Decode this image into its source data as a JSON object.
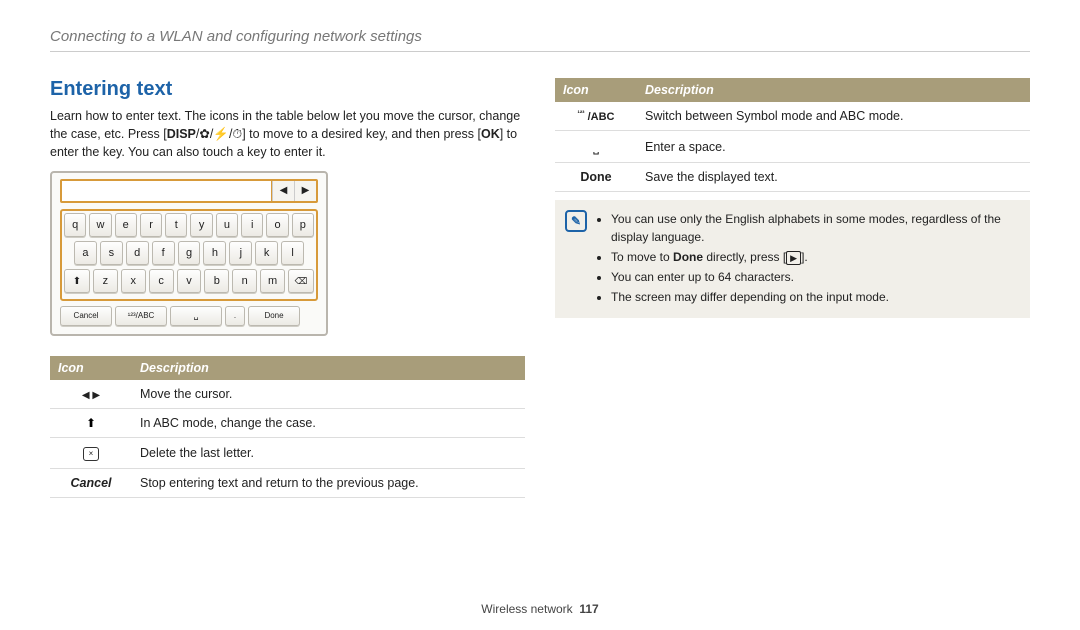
{
  "breadcrumb": "Connecting to a WLAN and configuring network settings",
  "section_title": "Entering text",
  "intro_1a": "Learn how to enter text. The icons in the table below let you move the cursor, change the case, etc. Press [",
  "intro_disp": "DISP",
  "intro_1b": "] to move to a desired key, and then press [",
  "intro_ok": "OK",
  "intro_1c": "] to enter the key. You can also touch a key to enter it.",
  "keyboard": {
    "row1": [
      "q",
      "w",
      "e",
      "r",
      "t",
      "y",
      "u",
      "i",
      "o",
      "p"
    ],
    "row2": [
      "a",
      "s",
      "d",
      "f",
      "g",
      "h",
      "j",
      "k",
      "l"
    ],
    "row3": [
      "z",
      "x",
      "c",
      "v",
      "b",
      "n",
      "m"
    ],
    "cancel": "Cancel",
    "mode": "¹²³/ABC",
    "dot": ".",
    "done": "Done"
  },
  "table_headers": {
    "icon": "Icon",
    "desc": "Description"
  },
  "table_left": [
    {
      "id": "lr",
      "desc": "Move the cursor."
    },
    {
      "id": "up",
      "desc": "In ABC mode, change the case."
    },
    {
      "id": "del",
      "desc": "Delete the last letter."
    },
    {
      "id": "cancel",
      "label": "Cancel",
      "desc": "Stop entering text and return to the previous page."
    }
  ],
  "table_right": [
    {
      "id": "mode",
      "label_pre": "¹²³",
      "label_post": " /ABC",
      "desc": "Switch between Symbol mode and ABC mode."
    },
    {
      "id": "space",
      "desc": "Enter a space."
    },
    {
      "id": "done",
      "label": "Done",
      "desc": "Save the displayed text."
    }
  ],
  "note": {
    "items": [
      "You can use only the English alphabets in some modes, regardless of the display language.",
      {
        "pre": "To move to ",
        "bold": "Done",
        "mid": " directly, press [",
        "key": "▶",
        "post": "]."
      },
      "You can enter up to 64 characters.",
      "The screen may differ depending on the input mode."
    ]
  },
  "footer": {
    "section": "Wireless network",
    "page": "117"
  }
}
